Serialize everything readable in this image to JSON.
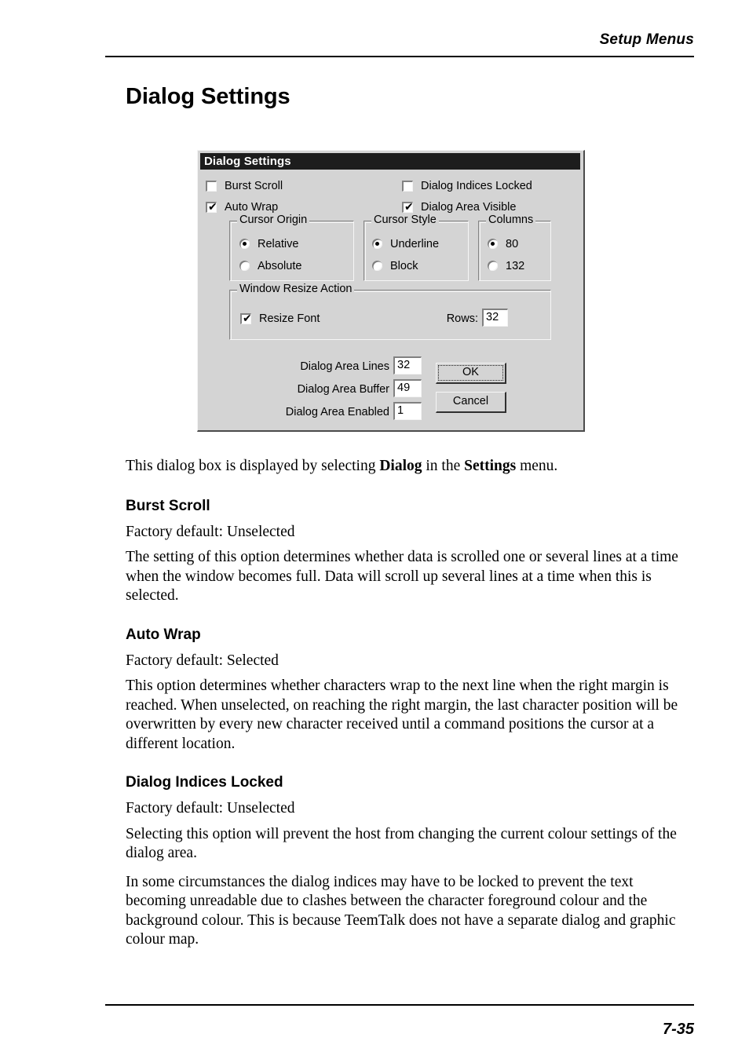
{
  "page": {
    "running_head": "Setup Menus",
    "title": "Dialog Settings",
    "folio": "7-35"
  },
  "dialog": {
    "titlebar": "Dialog Settings",
    "checkboxes": [
      {
        "label": "Burst Scroll",
        "checked": false,
        "mark": ""
      },
      {
        "label": "Auto Wrap",
        "checked": true,
        "mark": "✔"
      },
      {
        "label": "Dialog Indices Locked",
        "checked": false,
        "mark": ""
      },
      {
        "label": "Dialog Area Visible",
        "checked": true,
        "mark": "✔"
      },
      {
        "label": "Resize Font",
        "checked": true,
        "mark": "✔"
      }
    ],
    "groups": [
      {
        "title": "Cursor Origin",
        "options": [
          {
            "label": "Relative",
            "selected": true
          },
          {
            "label": "Absolute",
            "selected": false
          }
        ]
      },
      {
        "title": "Cursor Style",
        "options": [
          {
            "label": "Underline",
            "selected": true
          },
          {
            "label": "Block",
            "selected": false
          }
        ]
      },
      {
        "title": "Columns",
        "options": [
          {
            "label": "80",
            "selected": true
          },
          {
            "label": "132",
            "selected": false
          }
        ]
      },
      {
        "title": "Window Resize Action",
        "options": []
      }
    ],
    "fields": [
      {
        "label": "Rows:",
        "value": "32"
      },
      {
        "label": "Dialog Area Lines",
        "value": "32"
      },
      {
        "label": "Dialog Area Buffer",
        "value": "49"
      },
      {
        "label": "Dialog Area Enabled",
        "value": "1"
      }
    ],
    "buttons": [
      {
        "label": "OK",
        "focused": true
      },
      {
        "label": "Cancel",
        "focused": false
      }
    ]
  },
  "body": {
    "intro_1": "This dialog box is displayed by selecting ",
    "intro_bold_1": "Dialog",
    "intro_2": " in the ",
    "intro_bold_2": "Settings",
    "intro_3": " menu.",
    "sections": [
      {
        "heading": "Burst Scroll",
        "factory": "Factory default: Unselected",
        "paragraphs": [
          "The setting of this option determines whether data is scrolled one or several lines at a time when the window becomes full. Data will scroll up several lines at a time when this is selected."
        ]
      },
      {
        "heading": "Auto Wrap",
        "factory": "Factory default: Selected",
        "paragraphs": [
          "This option determines whether characters wrap to the next line when the right margin is reached. When unselected, on reaching the right margin, the last character position will be overwritten by every new character received until a command positions the cursor at a different location."
        ]
      },
      {
        "heading": "Dialog Indices Locked",
        "factory": "Factory default: Unselected",
        "paragraphs": [
          "Selecting this option will prevent the host from changing the current colour settings of the dialog area.",
          "In some circumstances the dialog indices may have to be locked to prevent the text becoming unreadable due to clashes between the character foreground colour and the background colour. This is because TeemTalk does not have a separate dialog and graphic colour map."
        ]
      }
    ]
  }
}
